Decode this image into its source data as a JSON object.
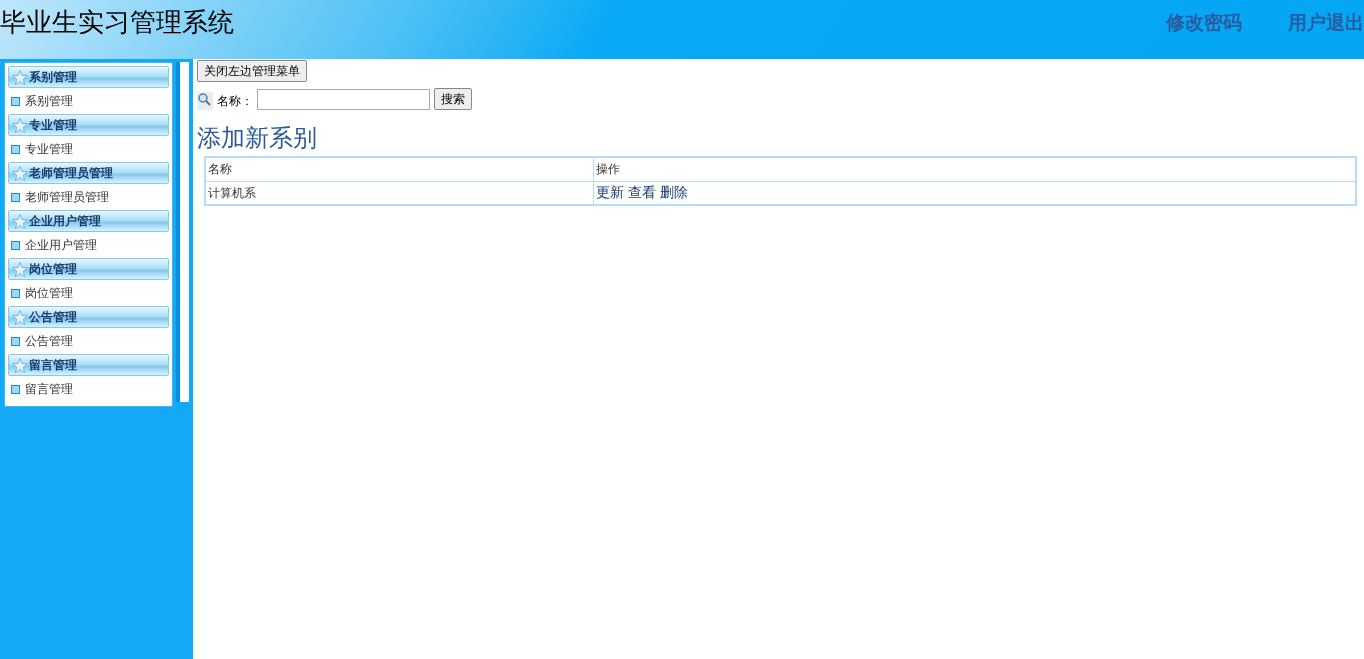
{
  "header": {
    "title": "毕业生实习管理系统",
    "links": [
      "修改密码",
      "用户退出"
    ]
  },
  "menu": [
    {
      "title": "系别管理",
      "items": [
        "系别管理"
      ]
    },
    {
      "title": "专业管理",
      "items": [
        "专业管理"
      ]
    },
    {
      "title": "老师管理员管理",
      "items": [
        "老师管理员管理"
      ]
    },
    {
      "title": "企业用户管理",
      "items": [
        "企业用户管理"
      ]
    },
    {
      "title": "岗位管理",
      "items": [
        "岗位管理"
      ]
    },
    {
      "title": "公告管理",
      "items": [
        "公告管理"
      ]
    },
    {
      "title": "留言管理",
      "items": [
        "留言管理"
      ]
    }
  ],
  "close_menu_button": "关闭左边管理菜单",
  "search": {
    "label": "名称：",
    "button": "搜索"
  },
  "heading": "添加新系别",
  "table": {
    "columns": [
      "名称",
      "操作"
    ],
    "rows": [
      {
        "name": "计算机系",
        "actions": [
          "更新",
          "查看",
          "删除"
        ]
      }
    ]
  }
}
